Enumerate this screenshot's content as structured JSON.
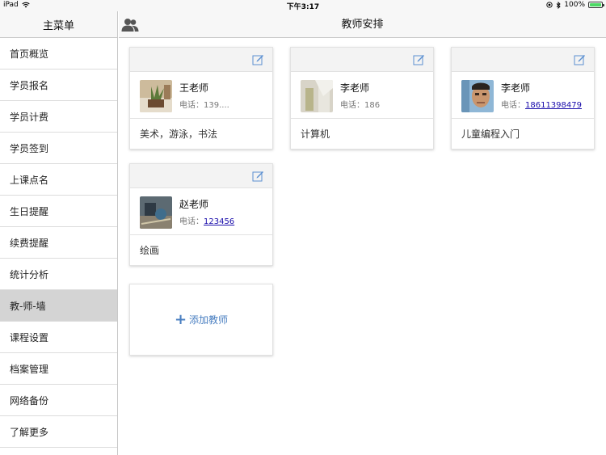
{
  "statusbar": {
    "device": "iPad",
    "time": "下午3:17",
    "battery": "100%"
  },
  "sidebar": {
    "title": "主菜单",
    "items": [
      {
        "label": "首页概览"
      },
      {
        "label": "学员报名"
      },
      {
        "label": "学员计费"
      },
      {
        "label": "学员签到"
      },
      {
        "label": "上课点名"
      },
      {
        "label": "生日提醒"
      },
      {
        "label": "续费提醒"
      },
      {
        "label": "统计分析"
      },
      {
        "label": "教-师-墙",
        "active": true
      },
      {
        "label": "课程设置"
      },
      {
        "label": "档案管理"
      },
      {
        "label": "网络备份"
      },
      {
        "label": "了解更多"
      }
    ]
  },
  "navbar": {
    "title": "教师安排"
  },
  "teachers": [
    {
      "name": "王老师",
      "phone_label": "电话：",
      "phone": "139....",
      "phone_link": false,
      "subjects": "美术，游泳，书法"
    },
    {
      "name": "李老师",
      "phone_label": "电话：",
      "phone": "186",
      "phone_link": false,
      "subjects": "计算机"
    },
    {
      "name": "李老师",
      "phone_label": "电话：",
      "phone": "18611398479",
      "phone_link": true,
      "subjects": "儿童编程入门"
    },
    {
      "name": "赵老师",
      "phone_label": "电话：",
      "phone": "123456",
      "phone_link": true,
      "subjects": "绘画"
    }
  ],
  "add_teacher": {
    "label": "添加教师"
  },
  "colors": {
    "accent": "#4a7fc1",
    "link": "#1a0dab",
    "active_row": "#d4d4d4"
  }
}
